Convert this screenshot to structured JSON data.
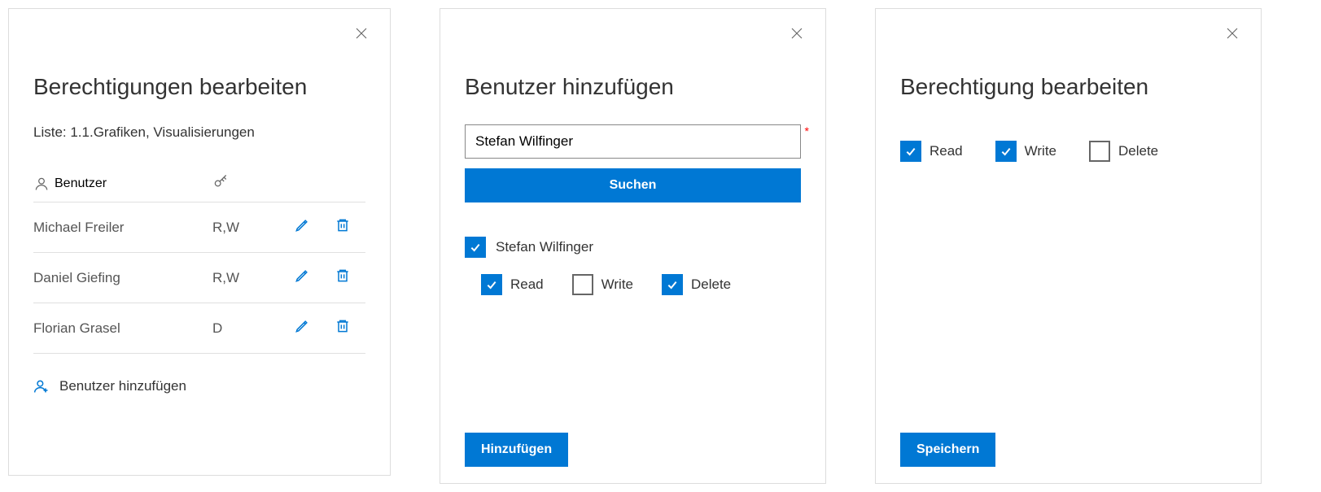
{
  "panel1": {
    "title": "Berechtigungen bearbeiten",
    "subtitle": "Liste: 1.1.Grafiken, Visualisierungen",
    "header_user": "Benutzer",
    "rows": [
      {
        "name": "Michael Freiler",
        "perm": "R,W"
      },
      {
        "name": "Daniel Giefing",
        "perm": "R,W"
      },
      {
        "name": "Florian Grasel",
        "perm": "D"
      }
    ],
    "add_user_label": "Benutzer hinzufügen"
  },
  "panel2": {
    "title": "Benutzer hinzufügen",
    "search_value": "Stefan Wilfinger",
    "search_btn": "Suchen",
    "result_name": "Stefan Wilfinger",
    "perms": {
      "read": {
        "label": "Read",
        "checked": true
      },
      "write": {
        "label": "Write",
        "checked": false
      },
      "delete": {
        "label": "Delete",
        "checked": true
      }
    },
    "add_btn": "Hinzufügen"
  },
  "panel3": {
    "title": "Berechtigung bearbeiten",
    "perms": {
      "read": {
        "label": "Read",
        "checked": true
      },
      "write": {
        "label": "Write",
        "checked": true
      },
      "delete": {
        "label": "Delete",
        "checked": false
      }
    },
    "save_btn": "Speichern"
  }
}
